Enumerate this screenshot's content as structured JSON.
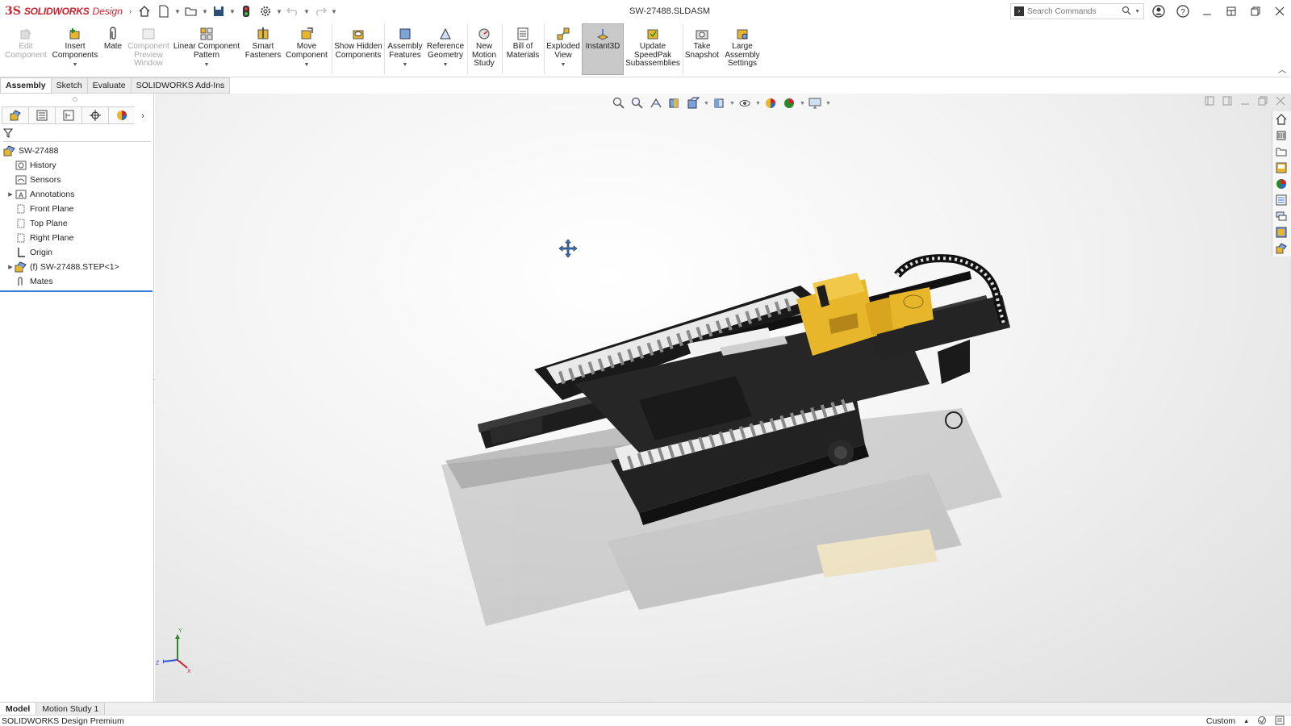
{
  "app": {
    "brand_prefix": "3S",
    "brand_name": "SOLIDWORKS",
    "brand_suffix": "Design",
    "document_title": "SW-27488.SLDASM",
    "search_placeholder": "Search Commands"
  },
  "ribbon": {
    "edit_component": "Edit Component",
    "insert_components": "Insert Components",
    "mate": "Mate",
    "component_preview_window": "Component Preview Window",
    "linear_component_pattern": "Linear Component Pattern",
    "smart_fasteners": "Smart Fasteners",
    "move_component": "Move Component",
    "show_hidden_components": "Show Hidden Components",
    "assembly_features": "Assembly Features",
    "reference_geometry": "Reference Geometry",
    "new_motion_study": "New Motion Study",
    "bill_of_materials": "Bill of Materials",
    "exploded_view": "Exploded View",
    "instant3d": "Instant3D",
    "update_speedpak": "Update SpeedPak Subassemblies",
    "take_snapshot": "Take Snapshot",
    "large_assembly_settings": "Large Assembly Settings"
  },
  "command_tabs": [
    "Assembly",
    "Sketch",
    "Evaluate",
    "SOLIDWORKS Add-Ins"
  ],
  "tree": {
    "root": "SW-27488",
    "items": [
      {
        "label": "History",
        "icon": "history-icon",
        "expandable": false
      },
      {
        "label": "Sensors",
        "icon": "sensors-icon",
        "expandable": false
      },
      {
        "label": "Annotations",
        "icon": "annotations-icon",
        "expandable": true
      },
      {
        "label": "Front Plane",
        "icon": "plane-icon",
        "expandable": false
      },
      {
        "label": "Top Plane",
        "icon": "plane-icon",
        "expandable": false
      },
      {
        "label": "Right Plane",
        "icon": "plane-icon",
        "expandable": false
      },
      {
        "label": "Origin",
        "icon": "origin-icon",
        "expandable": false
      },
      {
        "label": "(f) SW-27488.STEP<1>",
        "icon": "part-icon",
        "expandable": true
      },
      {
        "label": "Mates",
        "icon": "mates-icon",
        "expandable": false
      }
    ]
  },
  "bottom_tabs": [
    "Model",
    "Motion Study 1"
  ],
  "status": {
    "product": "SOLIDWORKS Design Premium",
    "units": "Custom"
  },
  "triad": {
    "x": "X",
    "y": "Y",
    "z": "Z"
  },
  "colors": {
    "brand_red": "#d0202e",
    "model_yellow": "#e8b62a",
    "model_dark": "#1d1d1d",
    "selection_blue": "#3a7bd5"
  }
}
